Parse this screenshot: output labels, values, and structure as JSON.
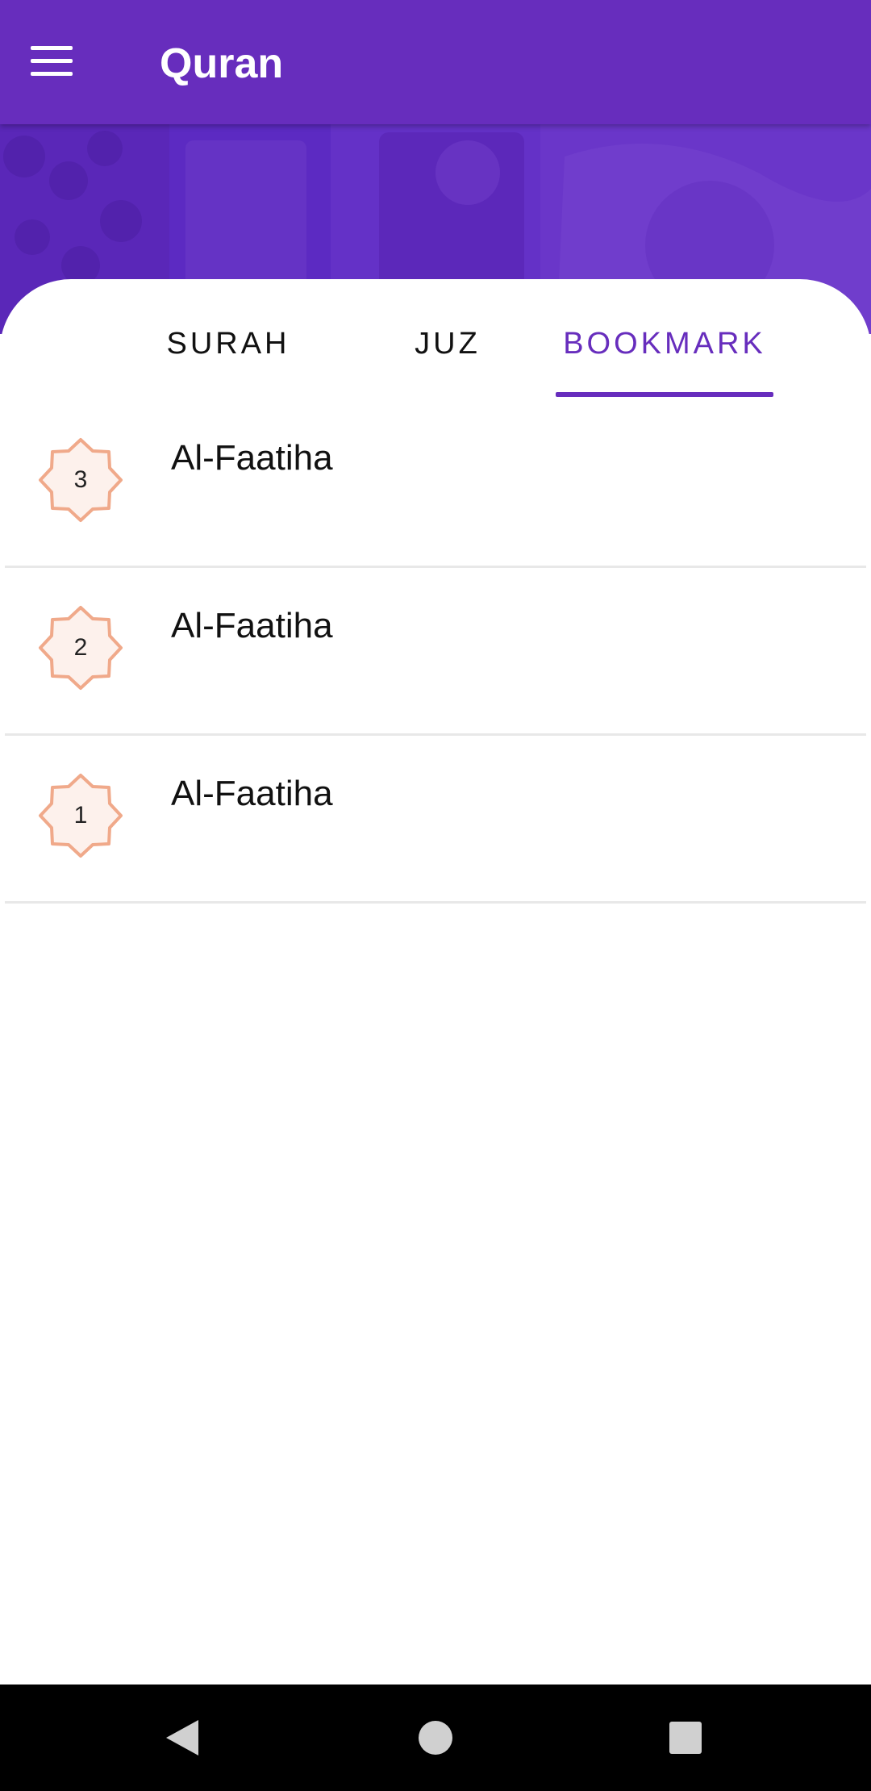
{
  "app": {
    "title": "Quran"
  },
  "icons": {
    "menu": "menu-icon",
    "back": "back-icon",
    "home": "home-icon",
    "recents": "recents-icon",
    "badge": "eight-point-star-icon"
  },
  "colors": {
    "primary": "#672dbd",
    "badge_fill": "#fdf1ec",
    "badge_stroke": "#f0a98a"
  },
  "tabs": [
    {
      "label": "SURAH",
      "active": false
    },
    {
      "label": "JUZ",
      "active": false
    },
    {
      "label": "BOOKMARK",
      "active": true
    }
  ],
  "bookmarks": [
    {
      "number": "3",
      "title": "Al-Faatiha"
    },
    {
      "number": "2",
      "title": "Al-Faatiha"
    },
    {
      "number": "1",
      "title": "Al-Faatiha"
    }
  ]
}
